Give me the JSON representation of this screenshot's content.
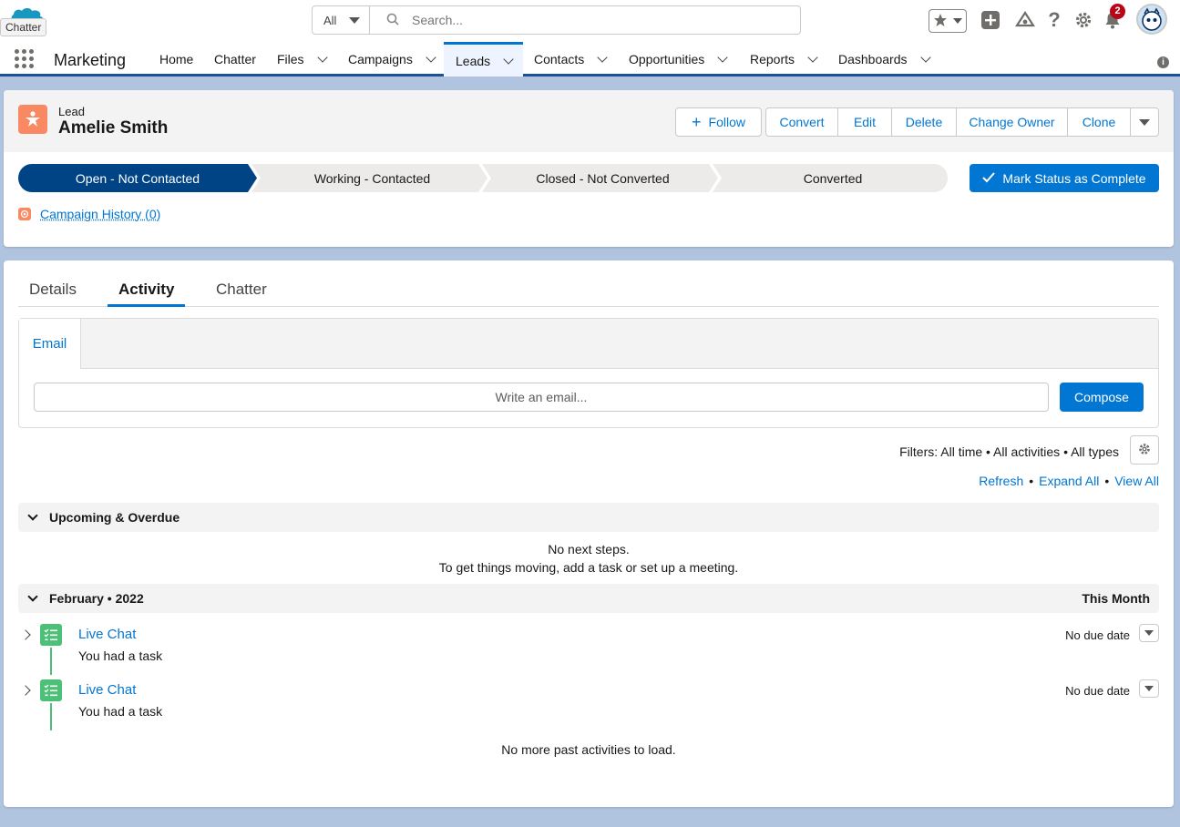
{
  "header": {
    "logo_tooltip": "Chatter",
    "search_scope": "All",
    "search_placeholder": "Search...",
    "notification_count": "2"
  },
  "nav": {
    "app_name": "Marketing",
    "items": [
      {
        "label": "Home"
      },
      {
        "label": "Chatter"
      },
      {
        "label": "Files"
      },
      {
        "label": "Campaigns"
      },
      {
        "label": "Leads"
      },
      {
        "label": "Contacts"
      },
      {
        "label": "Opportunities"
      },
      {
        "label": "Reports"
      },
      {
        "label": "Dashboards"
      }
    ]
  },
  "record": {
    "type": "Lead",
    "name": "Amelie Smith",
    "follow_label": "Follow",
    "actions": [
      "Convert",
      "Edit",
      "Delete",
      "Change Owner",
      "Clone"
    ],
    "path": [
      "Open - Not Contacted",
      "Working - Contacted",
      "Closed - Not Converted",
      "Converted"
    ],
    "mark_complete_label": "Mark Status as Complete",
    "campaign_history": "Campaign History (0)"
  },
  "activity": {
    "tabs": [
      "Details",
      "Activity",
      "Chatter"
    ],
    "publisher_tab": "Email",
    "email_placeholder": "Write an email...",
    "compose_label": "Compose",
    "filters_text": "Filters: All time • All activities • All types",
    "links": [
      "Refresh",
      "Expand All",
      "View All"
    ],
    "upcoming_title": "Upcoming & Overdue",
    "no_steps": "No next steps.",
    "no_steps_hint": "To get things moving, add a task or set up a meeting.",
    "month_title": "February • 2022",
    "month_right": "This Month",
    "items": [
      {
        "title": "Live Chat",
        "subtitle": "You had a task",
        "due": "No due date"
      },
      {
        "title": "Live Chat",
        "subtitle": "You had a task",
        "due": "No due date"
      }
    ],
    "no_more": "No more past activities to load."
  },
  "colors": {
    "brand_blue": "#0176d3",
    "path_active": "#014486",
    "lead_icon": "#f88962",
    "task_icon": "#4bc076",
    "badge_red": "#ba0517"
  }
}
